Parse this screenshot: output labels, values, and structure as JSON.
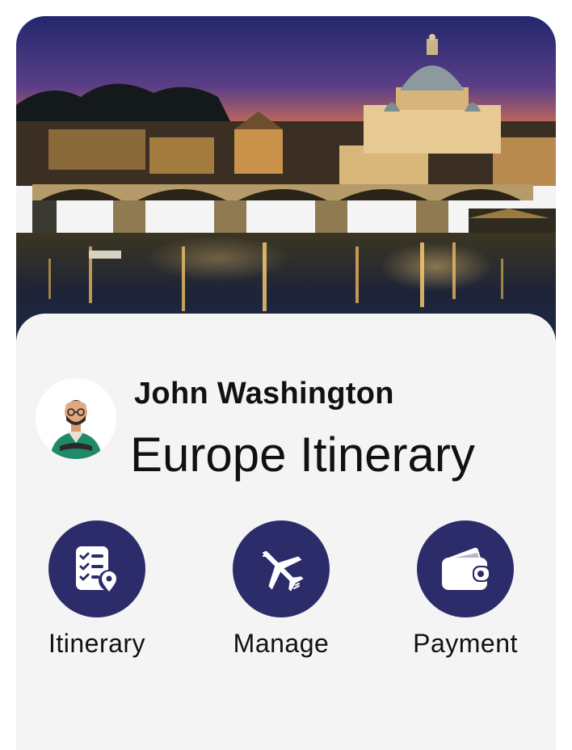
{
  "hero": {
    "image_subject": "night-view-of-river-bridge-and-domed-basilica"
  },
  "profile": {
    "name": "John Washington",
    "trip_title": "Europe Itinerary",
    "avatar_icon": "person-avatar-icon"
  },
  "actions": [
    {
      "label": "Itinerary",
      "icon": "checklist-location-icon"
    },
    {
      "label": "Manage",
      "icon": "airplane-icon"
    },
    {
      "label": "Payment",
      "icon": "wallet-icon"
    }
  ],
  "colors": {
    "accent": "#2d2c6b",
    "panel": "#f4f4f5",
    "text": "#111111"
  }
}
